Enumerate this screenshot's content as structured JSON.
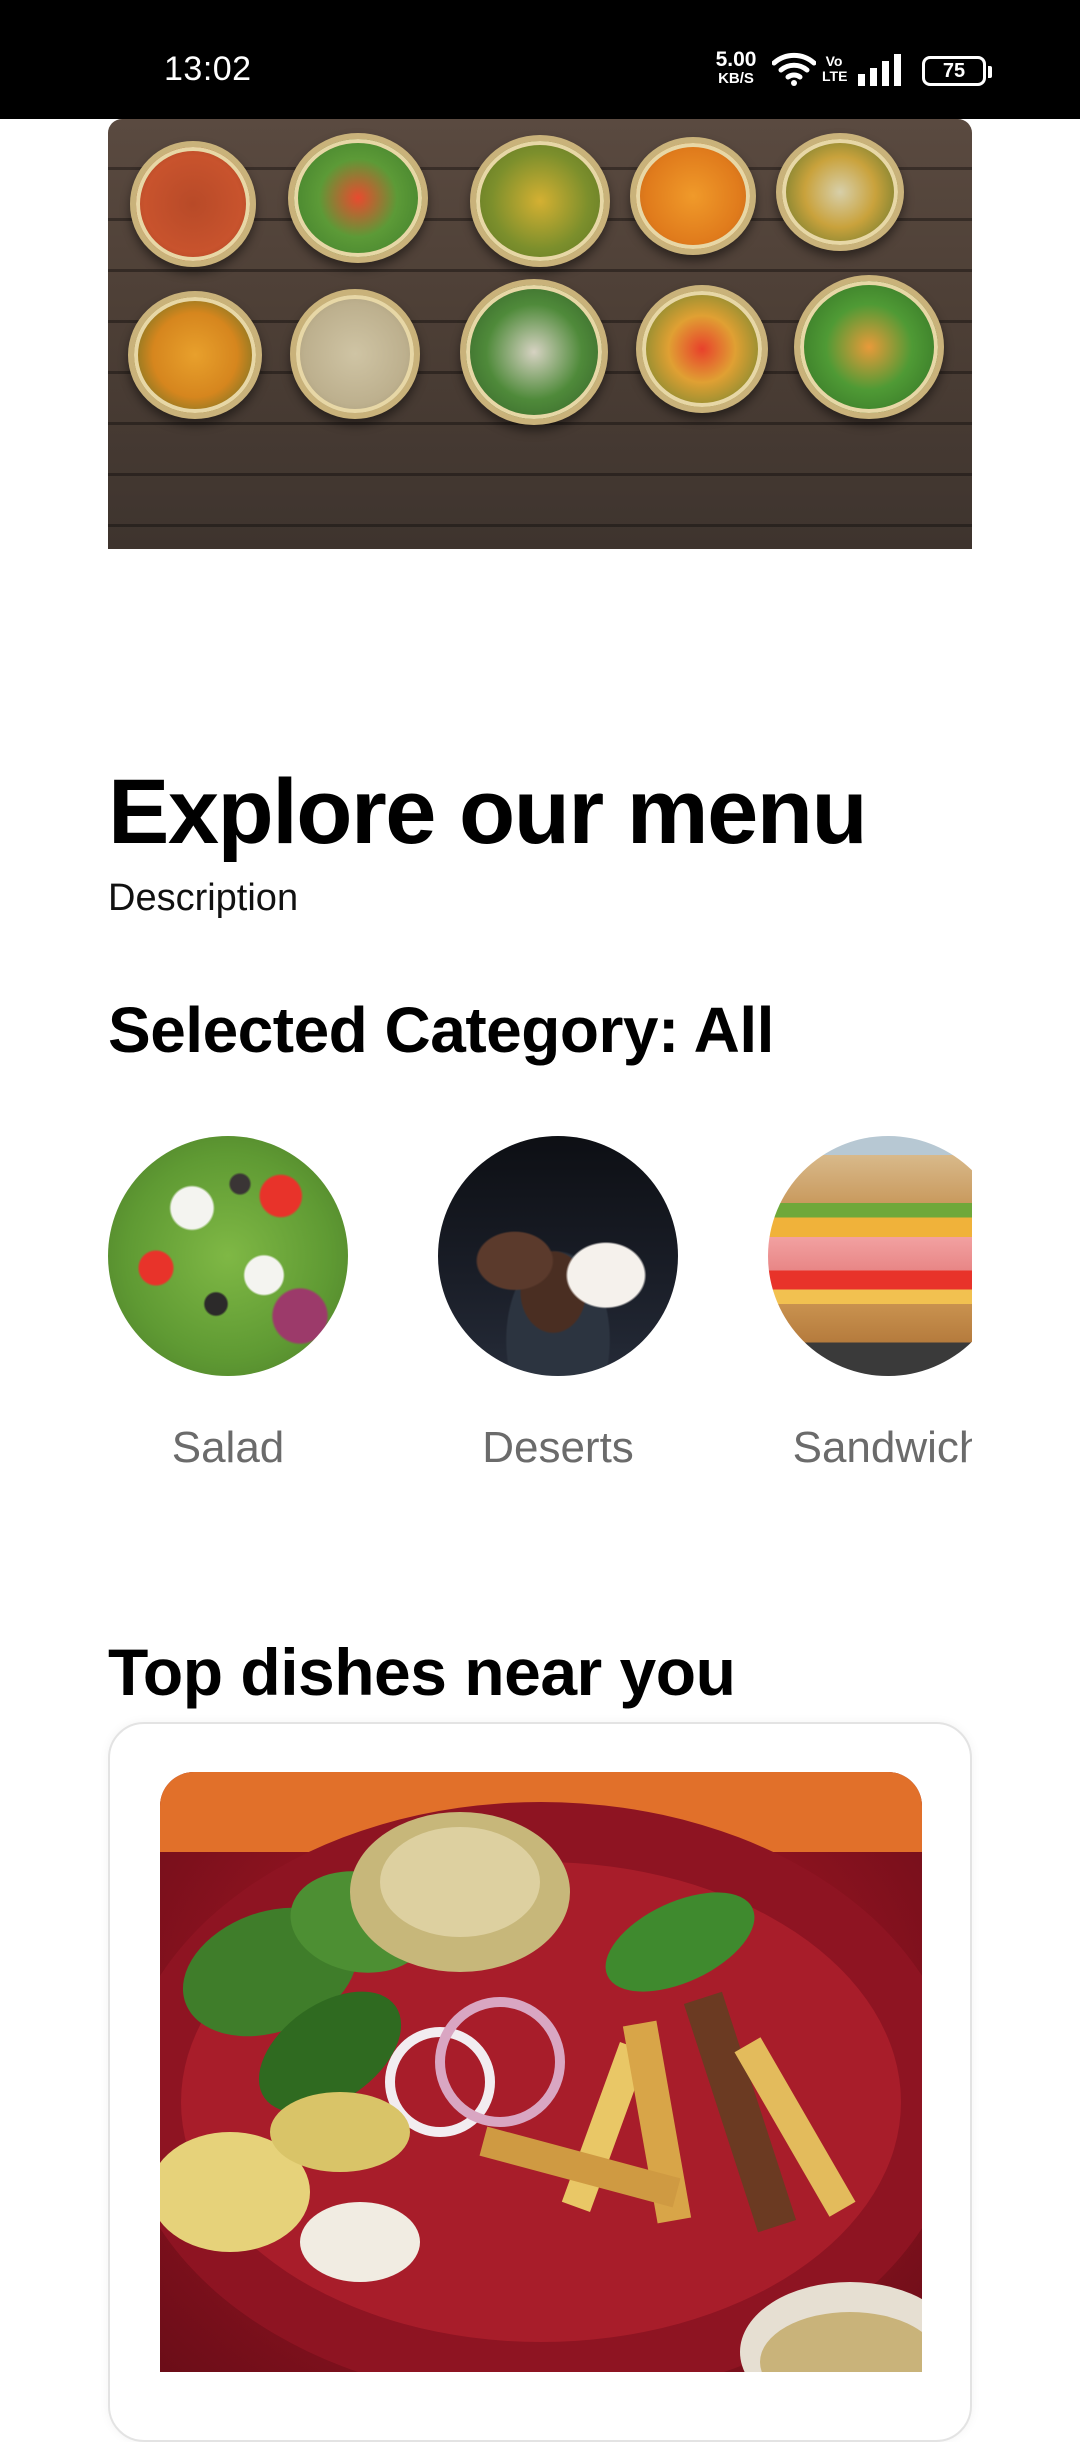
{
  "status_bar": {
    "time": "13:02",
    "net_speed_value": "5.00",
    "net_speed_unit": "KB/S",
    "volte_top": "Vo",
    "volte_bottom": "LTE",
    "battery": "75"
  },
  "hero": {
    "image": "thali-bowls-on-wooden-table-photo"
  },
  "menu": {
    "title": "Explore our menu",
    "description": "Description",
    "selected_category": "Selected Category: All"
  },
  "categories": [
    {
      "label": "Salad",
      "image": "greek-salad-photo"
    },
    {
      "label": "Deserts",
      "image": "chocolate-cookies-ice-cream-photo"
    },
    {
      "label": "Sandwich",
      "image": "ham-cheese-sandwich-photo"
    }
  ],
  "top_dishes": {
    "title": "Top dishes near you",
    "items": [
      {
        "image": "sprout-salad-with-fries-photo"
      }
    ]
  },
  "colors": {
    "status_bar_bg": "#000000",
    "background": "#ffffff",
    "category_label": "#6b6b6b",
    "card_border": "#e3e3e3"
  }
}
